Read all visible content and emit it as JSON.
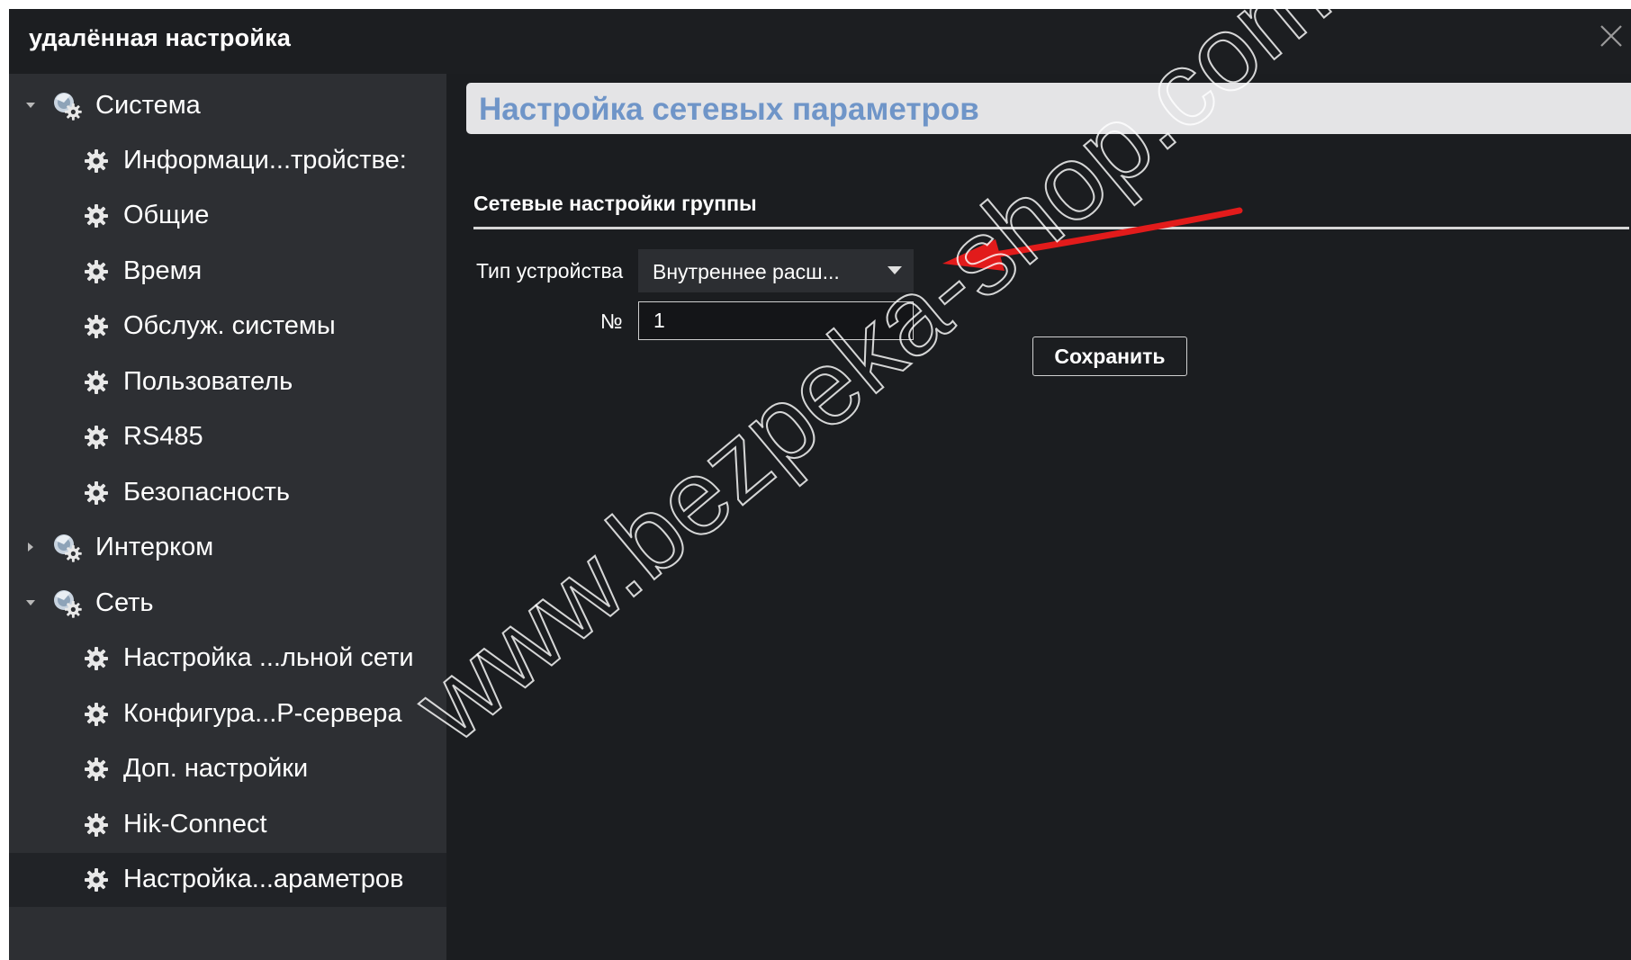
{
  "window": {
    "title": "удалённая настройка",
    "close_icon": "close-icon"
  },
  "sidebar": {
    "groups": [
      {
        "label": "Система",
        "expanded": true,
        "icon": "system-settings-icon",
        "items": [
          {
            "label": "Информаци...тройстве:",
            "icon": "gear-icon"
          },
          {
            "label": "Общие",
            "icon": "gear-icon"
          },
          {
            "label": "Время",
            "icon": "gear-icon"
          },
          {
            "label": "Обслуж. системы",
            "icon": "gear-icon"
          },
          {
            "label": "Пользователь",
            "icon": "gear-icon"
          },
          {
            "label": "RS485",
            "icon": "gear-icon"
          },
          {
            "label": "Безопасность",
            "icon": "gear-icon"
          }
        ]
      },
      {
        "label": "Интерком",
        "expanded": false,
        "icon": "system-settings-icon",
        "items": []
      },
      {
        "label": "Сеть",
        "expanded": true,
        "icon": "system-settings-icon",
        "items": [
          {
            "label": "Настройка ...льной сети",
            "icon": "gear-icon"
          },
          {
            "label": "Конфигура...Р-сервера",
            "icon": "gear-icon"
          },
          {
            "label": "Доп. настройки",
            "icon": "gear-icon"
          },
          {
            "label": "Hik-Connect",
            "icon": "gear-icon"
          },
          {
            "label": "Настройка...араметров",
            "icon": "gear-icon",
            "selected": true
          }
        ]
      }
    ]
  },
  "main": {
    "page_title": "Настройка сетевых параметров",
    "section_title": "Сетевые настройки группы",
    "device_type_label": "Тип устройства",
    "device_type_value": "Внутреннее расш...",
    "number_label": "№",
    "number_value": "1",
    "save_label": "Сохранить"
  },
  "watermark": "www.bezpeka-shop.com",
  "colors": {
    "title_bar": "#1c1e21",
    "sidebar": "#2d2f33",
    "selected_item": "#212327",
    "content": "#1b1d20",
    "page_title_text": "#6f95c8",
    "header_bar": "#e4e4e6",
    "annotation_arrow": "#e21b1b"
  }
}
